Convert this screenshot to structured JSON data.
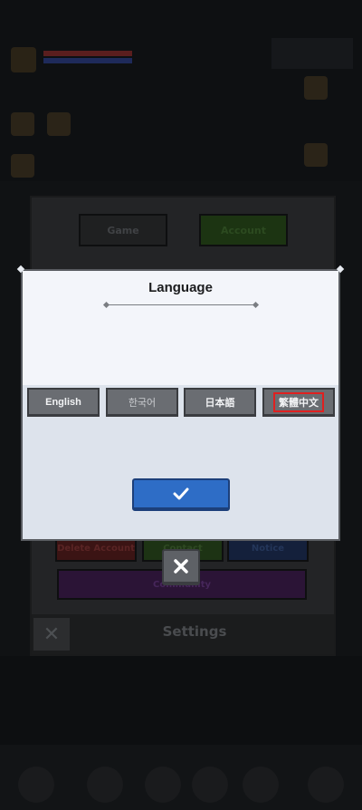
{
  "settings": {
    "tab_game": "Game",
    "tab_account": "Account",
    "delete_account": "Delete Account",
    "contact": "Contact",
    "notice": "Notice",
    "community": "Community",
    "title": "Settings"
  },
  "language_modal": {
    "title": "Language",
    "options": [
      {
        "label": "English"
      },
      {
        "label": "한국어"
      },
      {
        "label": "日本語"
      },
      {
        "label": "繁體中文",
        "highlighted": true
      }
    ],
    "confirm_icon": "checkmark-icon",
    "close_icon": "close-icon"
  },
  "colors": {
    "confirm": "#2e6dc6",
    "option_bg": "#6a6d72",
    "highlight": "#e02020",
    "modal_bg": "#dde3ec"
  }
}
